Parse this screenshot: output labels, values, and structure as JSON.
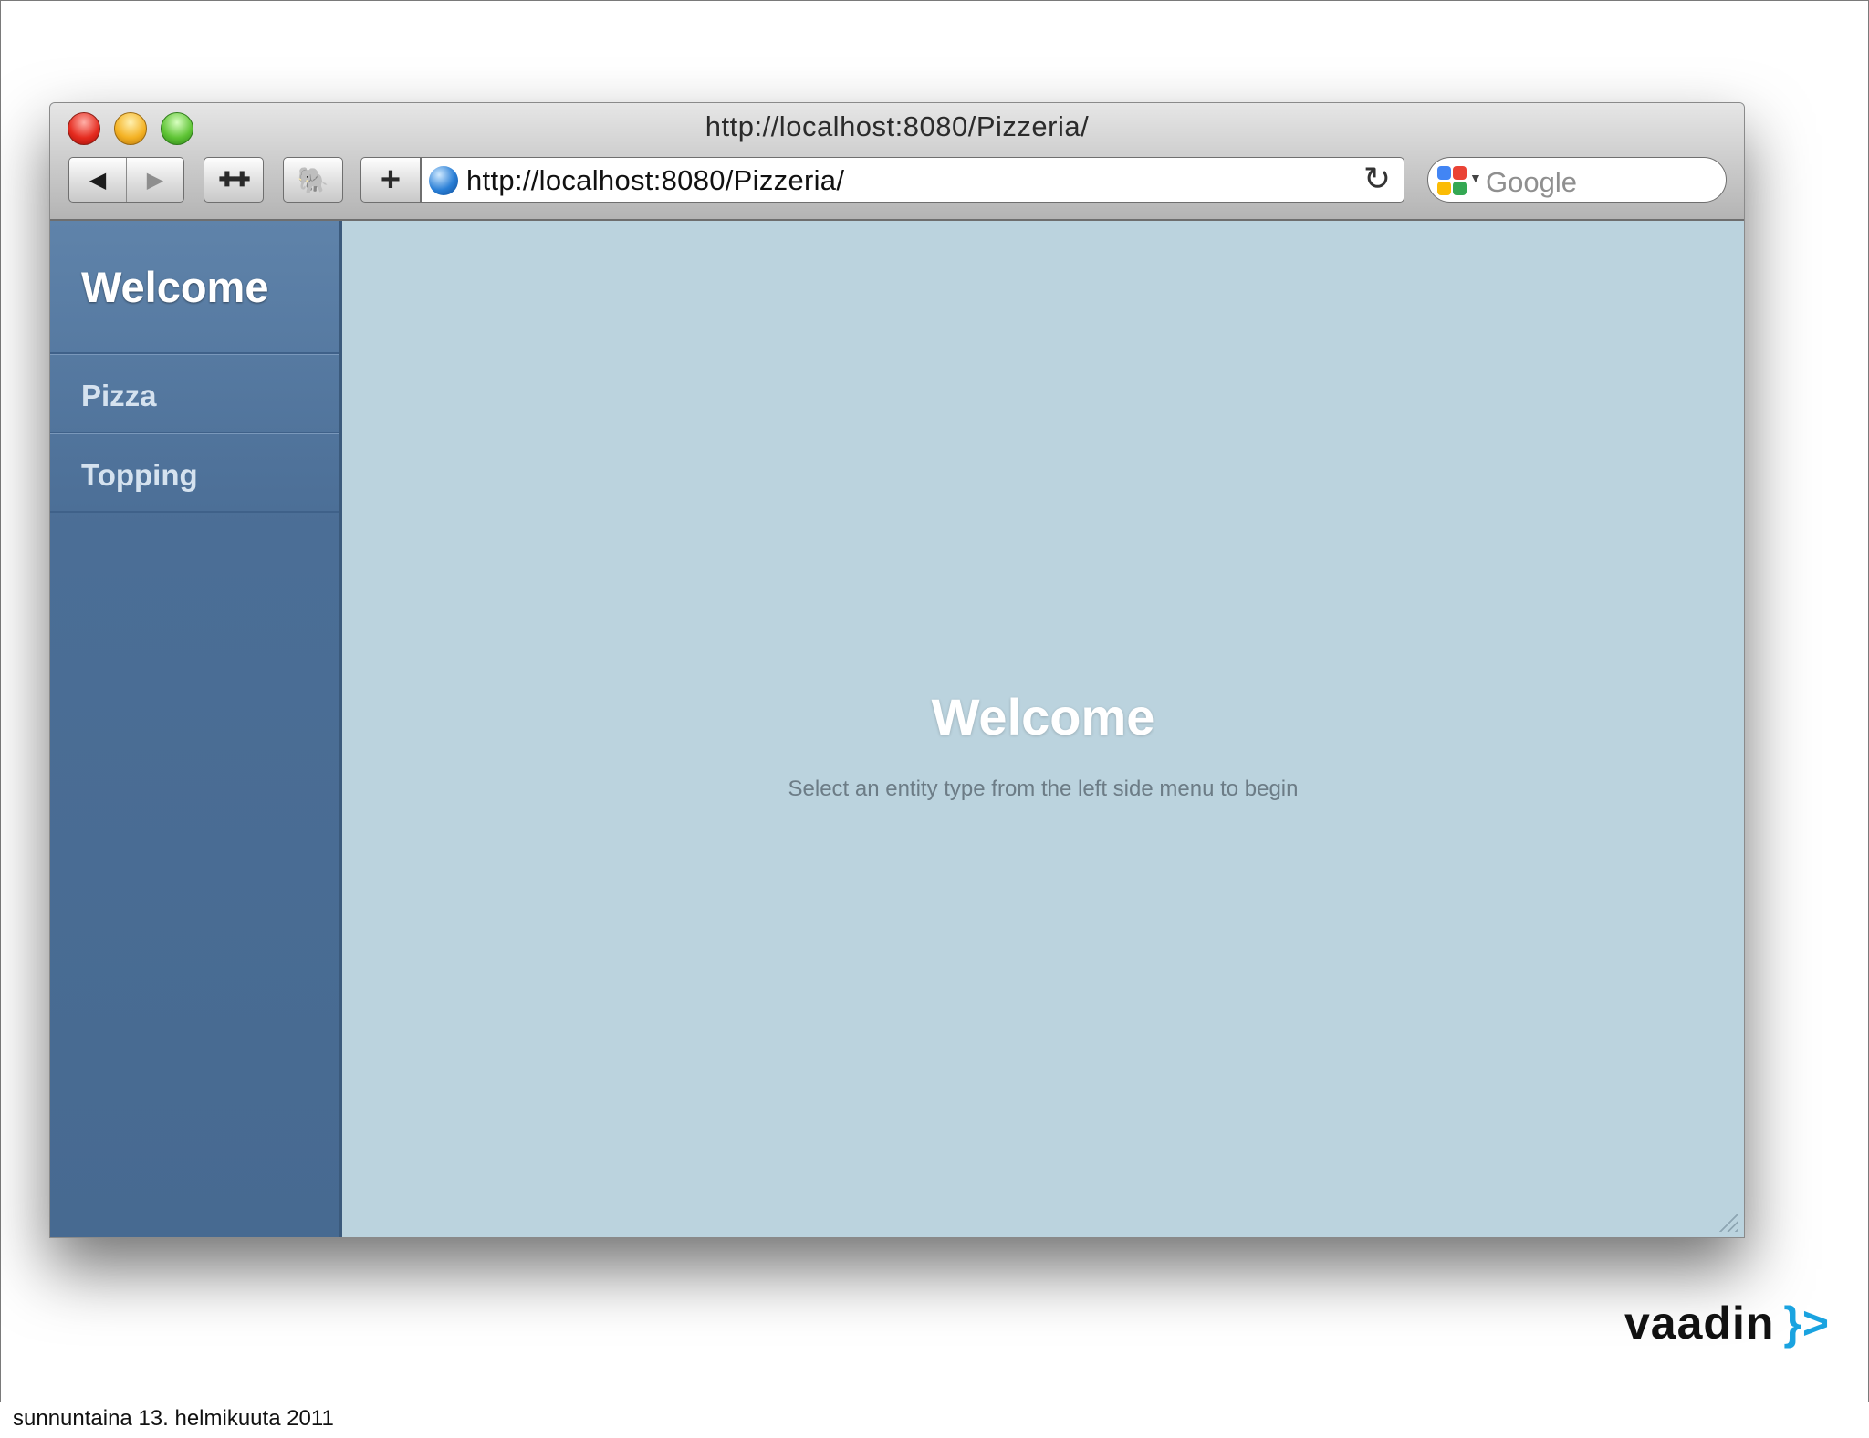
{
  "window": {
    "title": "http://localhost:8080/Pizzeria/"
  },
  "toolbar": {
    "back_glyph": "◀",
    "forward_glyph": "▶",
    "snippet_glyph": "✚✚",
    "evernote_glyph": "🐘",
    "add_bookmark_glyph": "+",
    "reload_glyph": "↻",
    "url": "http://localhost:8080/Pizzeria/",
    "search_placeholder": "Google"
  },
  "sidebar": {
    "header": "Welcome",
    "items": [
      {
        "label": "Pizza"
      },
      {
        "label": "Topping"
      }
    ]
  },
  "main": {
    "title": "Welcome",
    "subtitle": "Select an entity type from the left side menu to begin"
  },
  "branding": {
    "logo_text": "vaadin",
    "logo_mark": "}>",
    "accent_color": "#1aa3e0"
  },
  "footer": {
    "date": "sunnuntaina 13. helmikuuta 2011"
  },
  "colors": {
    "sidebar": "#476a91",
    "content": "#bbd3de"
  }
}
